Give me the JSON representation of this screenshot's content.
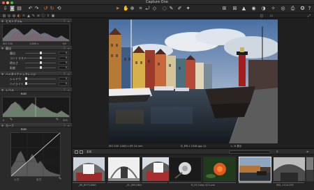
{
  "app": {
    "title": "Capture One",
    "colors": {
      "accent": "#e57a2a",
      "traffic_close": "#ec5f57",
      "traffic_min": "#f2c14b",
      "traffic_max": "#3fc03f"
    }
  },
  "toolbar": {
    "icons": [
      "import-icon",
      "camera-icon",
      "browse-icon",
      "undo-icon",
      "redo-icon",
      "rotate-icon",
      "crop-icon",
      "grid-icon",
      "hand-icon",
      "zoom-icon",
      "keystone-icon",
      "spot-icon",
      "picker-icon",
      "brush-icon",
      "eraser-icon",
      "text-icon",
      "cursor-tool-icon"
    ]
  },
  "left_panel": {
    "histogram": {
      "title": "ヒストグラム",
      "iso": "ISO 200",
      "shutter": "1/400 s",
      "aperture": "f/9"
    },
    "exposure": {
      "title": "露出",
      "sliders": [
        {
          "label": "露出",
          "value": "0",
          "level": 0.5
        },
        {
          "label": "コントラスト",
          "value": "0",
          "level": 0.5
        },
        {
          "label": "明るさ",
          "value": "0",
          "level": 0.5
        },
        {
          "label": "彩度",
          "value": "0",
          "level": 0.5
        }
      ]
    },
    "hdr": {
      "title": "ハイダイナミックレンジ",
      "sliders": [
        {
          "label": "シャドウ",
          "value": "0",
          "level": 0.0
        },
        {
          "label": "ハイライト",
          "value": "0",
          "level": 0.0
        }
      ]
    },
    "levels": {
      "title": "レベル",
      "channel": "RGB",
      "low": "0",
      "high": "255"
    },
    "curve": {
      "title": "カーブ",
      "channel": "RGB",
      "in_label": "入力",
      "out_label": "出力"
    }
  },
  "viewer": {
    "status_left": "ISO 200  1/400 s  f/9  14 mm",
    "filename": "D_EPL1 2318.jpg (1)",
    "status_right": "1 / 6 表示"
  },
  "browser": {
    "title": "名前",
    "search_placeholder": "",
    "captions": [
      "_DS_8573.DNG",
      "",
      "_01_099.DNG",
      "",
      "N_03 Colby 423.arw",
      "",
      "IMG_1124.CR2"
    ]
  }
}
